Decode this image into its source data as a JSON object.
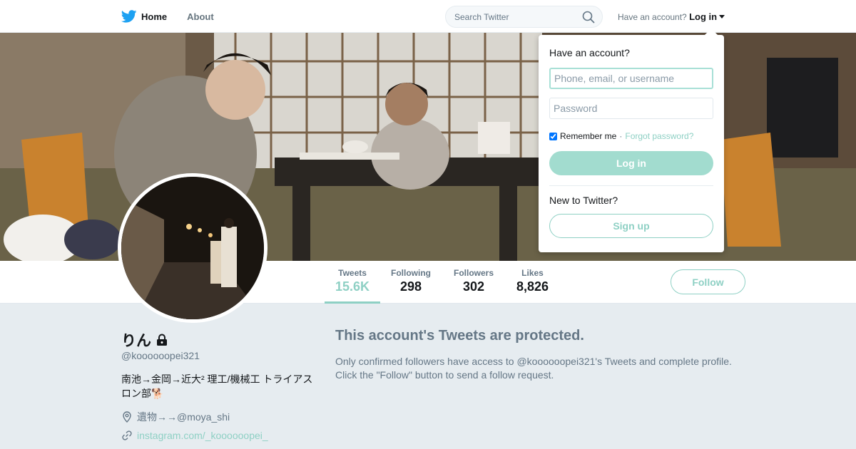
{
  "nav": {
    "home_label": "Home",
    "about_label": "About",
    "search_placeholder": "Search Twitter",
    "have_account": "Have an account?",
    "login_label": "Log in"
  },
  "profile": {
    "name": "りん",
    "handle": "@koooooopei321",
    "bio": "南池→金岡→近大² 理工/機械工 トライアスロン部🐕",
    "location": "遺物→→@moya_shi",
    "url": "instagram.com/_koooooopei_"
  },
  "stats": [
    {
      "label": "Tweets",
      "value": "15.6K"
    },
    {
      "label": "Following",
      "value": "298"
    },
    {
      "label": "Followers",
      "value": "302"
    },
    {
      "label": "Likes",
      "value": "8,826"
    }
  ],
  "follow_label": "Follow",
  "protected": {
    "title": "This account's Tweets are protected.",
    "body": "Only confirmed followers have access to @koooooopei321's Tweets and complete profile. Click the \"Follow\" button to send a follow request."
  },
  "login_dropdown": {
    "title": "Have an account?",
    "username_placeholder": "Phone, email, or username",
    "password_placeholder": "Password",
    "remember_label": "Remember me",
    "forgot_label": "Forgot password?",
    "login_button": "Log in",
    "new_label": "New to Twitter?",
    "signup_button": "Sign up"
  },
  "colors": {
    "accent": "#8ed0c4",
    "twitter_blue": "#1da1f2"
  }
}
